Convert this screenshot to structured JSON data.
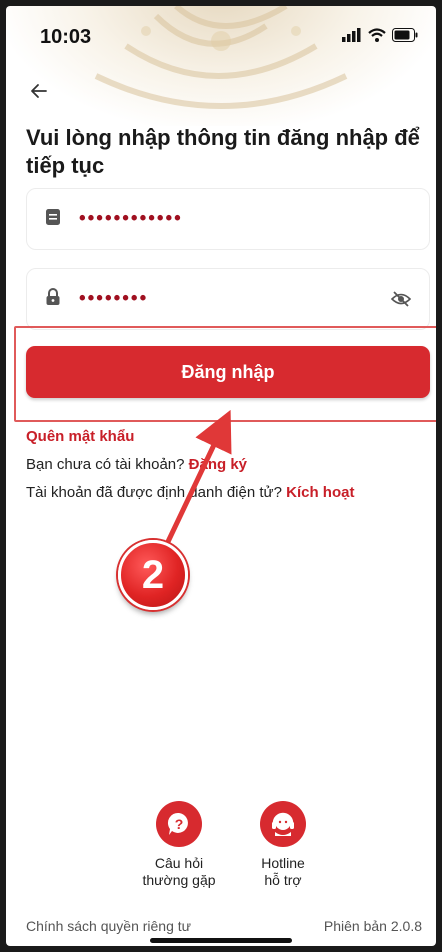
{
  "status_bar": {
    "time": "10:03",
    "icons": [
      "signal-icon",
      "wifi-icon",
      "battery-icon"
    ]
  },
  "header": {
    "back_icon": "arrow-left-icon"
  },
  "title": "Vui lòng nhập thông tin đăng nhập để tiếp tục",
  "form": {
    "username": {
      "icon": "id-card-icon",
      "value": "••••••••••••"
    },
    "password": {
      "icon": "lock-icon",
      "value": "••••••••",
      "toggle_icon": "eye-slash-icon"
    },
    "login_label": "Đăng nhập"
  },
  "links": {
    "forgot_password": "Quên mật khẩu",
    "register_prefix": "Bạn chưa có tài khoản?",
    "register_link": "Đăng ký",
    "activate_prefix": "Tài khoản đã được định danh điện tử?",
    "activate_link": "Kích hoạt"
  },
  "annotation": {
    "step_number": "2"
  },
  "help": {
    "faq_label_1": "Câu hỏi",
    "faq_label_2": "thường gặp",
    "hotline_label_1": "Hotline",
    "hotline_label_2": "hỗ trợ"
  },
  "footer": {
    "privacy": "Chính sách quyền riêng tư",
    "version": "Phiên bản 2.0.8"
  },
  "colors": {
    "primary": "#d72a2f",
    "link": "#c81f28",
    "dots": "#a01020"
  }
}
